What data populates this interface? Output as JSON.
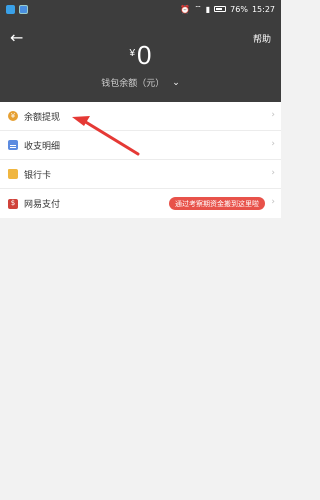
{
  "status_bar": {
    "battery": "76%",
    "time": "15:27"
  },
  "header": {
    "back_icon": "←",
    "help_label": "帮助",
    "currency": "¥",
    "balance": "0",
    "subtitle": "钱包余额（元）",
    "chevron": "⌄"
  },
  "menu": {
    "items": [
      {
        "label": "余额提现",
        "icon": "coin-icon",
        "icon_text": "¥"
      },
      {
        "label": "收支明细",
        "icon": "bill-icon",
        "icon_text": ""
      },
      {
        "label": "银行卡",
        "icon": "folder-icon",
        "icon_text": ""
      },
      {
        "label": "网易支付",
        "icon": "netease-pay-icon",
        "icon_text": "$",
        "badge": "通过考察期资金搬到这里啦"
      }
    ],
    "arrow": "›"
  },
  "colors": {
    "header_bg": "#3d3d3d",
    "badge": "#e8524a",
    "annotation": "#e53935"
  }
}
